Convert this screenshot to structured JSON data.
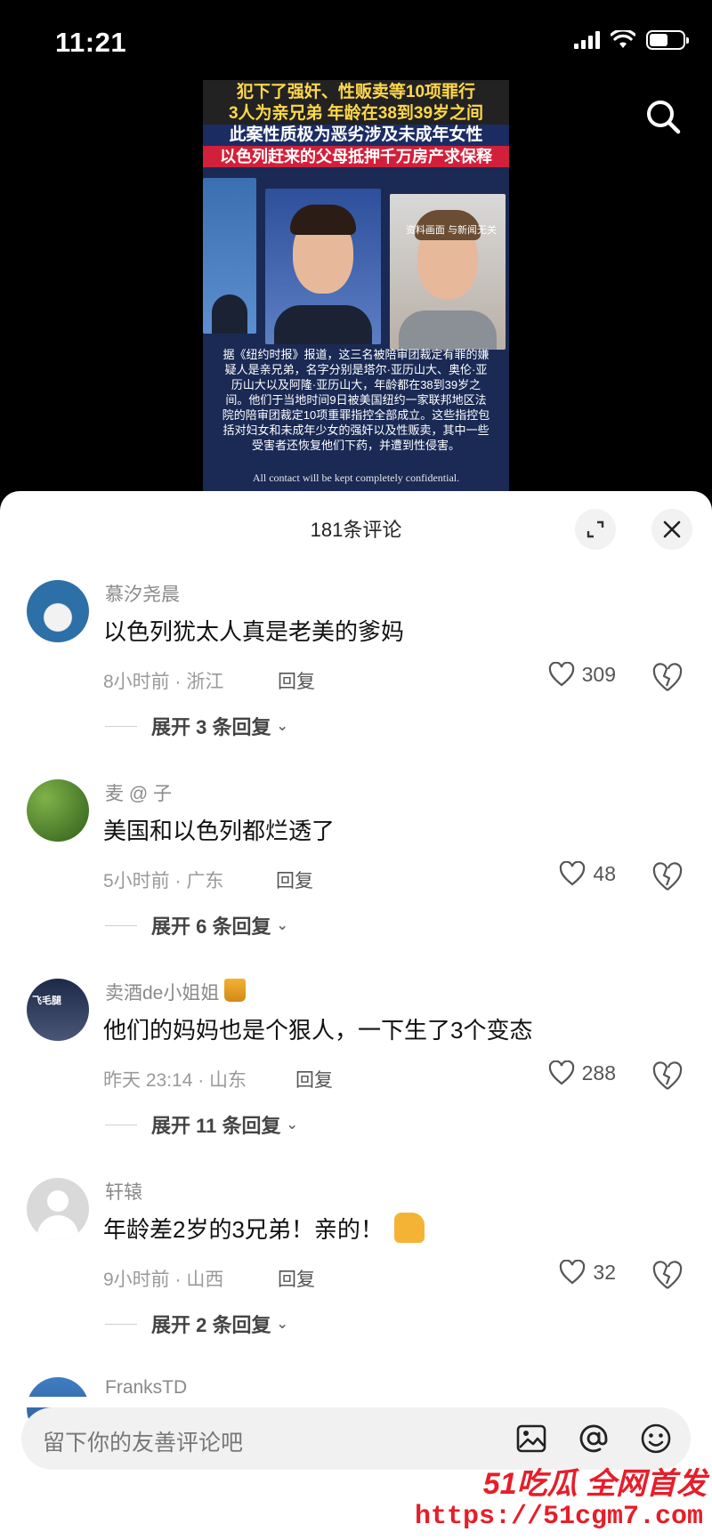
{
  "status_bar": {
    "time": "11:21",
    "battery_level": 0.55
  },
  "video": {
    "caption_lines": [
      "犯下了强奸、性贩卖等10项罪行",
      "3人为亲兄弟 年龄在38到39岁之间",
      "此案性质极为恶劣涉及未成年女性",
      "以色列赶来的父母抵押千万房产求保释"
    ],
    "disclaimer": "资料画面 与新闻无关",
    "article": "据《纽约时报》报道，这三名被陪审团裁定有罪的嫌疑人是亲兄弟，名字分别是塔尔·亚历山大、奥伦·亚历山大以及阿隆·亚历山大，年龄都在38到39岁之间。他们于当地时间9日被美国纽约一家联邦地区法院的陪审团裁定10项重罪指控全部成立。这些指控包括对妇女和未成年少女的强奸以及性贩卖，其中一些受害者还恢复他们下药，并遭到性侵害。",
    "contact": "All contact will be kept completely confidential."
  },
  "sheet": {
    "title": "181条评论"
  },
  "comments": [
    {
      "user": "慕汐尧晨",
      "text": "以色列犹太人真是老美的爹妈",
      "meta": "8小时前 · 浙江",
      "reply": "回复",
      "likes": "309",
      "expand": "展开 3 条回复"
    },
    {
      "user": "麦 @ 子",
      "text": "美国和以色列都烂透了",
      "meta": "5小时前 · 广东",
      "reply": "回复",
      "likes": "48",
      "expand": "展开 6 条回复"
    },
    {
      "user": "卖酒de小姐姐",
      "text": "他们的妈妈也是个狠人，一下生了3个变态",
      "meta": "昨天 23:14 · 山东",
      "reply": "回复",
      "likes": "288",
      "expand": "展开 11 条回复",
      "avatar_sign": "飞毛腿"
    },
    {
      "user": "轩辕",
      "text": "年龄差2岁的3兄弟！亲的！",
      "meta": "9小时前 · 山西",
      "reply": "回复",
      "likes": "32",
      "expand": "展开 2 条回复"
    },
    {
      "user": "FranksTD"
    }
  ],
  "input": {
    "placeholder": "留下你的友善评论吧"
  },
  "watermark": {
    "top": "51吃瓜 全网首发",
    "bottom": "https://51cgm7.com"
  },
  "colors": {
    "watermark": "#e61e2a",
    "caption_yellow": "#ffd84a",
    "caption_red": "#d3203a"
  }
}
